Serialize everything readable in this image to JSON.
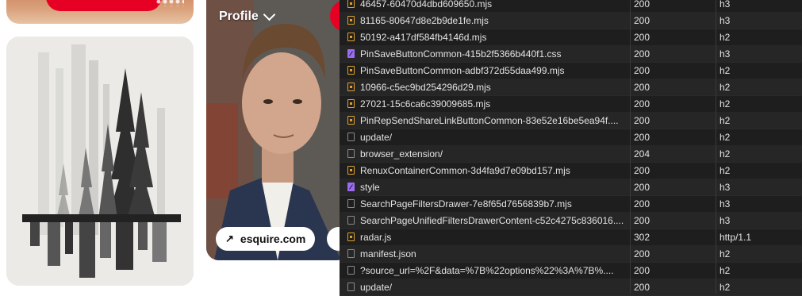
{
  "pinterest": {
    "profile_label": "Profile",
    "source_link": "esquire.com"
  },
  "network": {
    "rows": [
      {
        "name": "46457-60470d4dbd609650.mjs",
        "status": "200",
        "protocol": "h3",
        "type": "script"
      },
      {
        "name": "81165-80647d8e2b9de1fe.mjs",
        "status": "200",
        "protocol": "h3",
        "type": "script"
      },
      {
        "name": "50192-a417df584fb4146d.mjs",
        "status": "200",
        "protocol": "h2",
        "type": "script"
      },
      {
        "name": "PinSaveButtonCommon-415b2f5366b440f1.css",
        "status": "200",
        "protocol": "h3",
        "type": "style"
      },
      {
        "name": "PinSaveButtonCommon-adbf372d55daa499.mjs",
        "status": "200",
        "protocol": "h2",
        "type": "script"
      },
      {
        "name": "10966-c5ec9bd254296d29.mjs",
        "status": "200",
        "protocol": "h2",
        "type": "script"
      },
      {
        "name": "27021-15c6ca6c39009685.mjs",
        "status": "200",
        "protocol": "h2",
        "type": "script"
      },
      {
        "name": "PinRepSendShareLinkButtonCommon-83e52e16be5ea94f....",
        "status": "200",
        "protocol": "h2",
        "type": "script"
      },
      {
        "name": "update/",
        "status": "200",
        "protocol": "h2",
        "type": "doc"
      },
      {
        "name": "browser_extension/",
        "status": "204",
        "protocol": "h2",
        "type": "doc"
      },
      {
        "name": "RenuxContainerCommon-3d4fa9d7e09bd157.mjs",
        "status": "200",
        "protocol": "h2",
        "type": "script"
      },
      {
        "name": "style",
        "status": "200",
        "protocol": "h3",
        "type": "style"
      },
      {
        "name": "SearchPageFiltersDrawer-7e8f65d7656839b7.mjs",
        "status": "200",
        "protocol": "h3",
        "type": "doc"
      },
      {
        "name": "SearchPageUnifiedFiltersDrawerContent-c52c4275c836016....",
        "status": "200",
        "protocol": "h3",
        "type": "doc"
      },
      {
        "name": "radar.js",
        "status": "302",
        "protocol": "http/1.1",
        "type": "script"
      },
      {
        "name": "manifest.json",
        "status": "200",
        "protocol": "h2",
        "type": "doc"
      },
      {
        "name": "?source_url=%2F&data=%7B%22options%22%3A%7B%....",
        "status": "200",
        "protocol": "h2",
        "type": "doc"
      },
      {
        "name": "update/",
        "status": "200",
        "protocol": "h2",
        "type": "doc"
      }
    ]
  }
}
